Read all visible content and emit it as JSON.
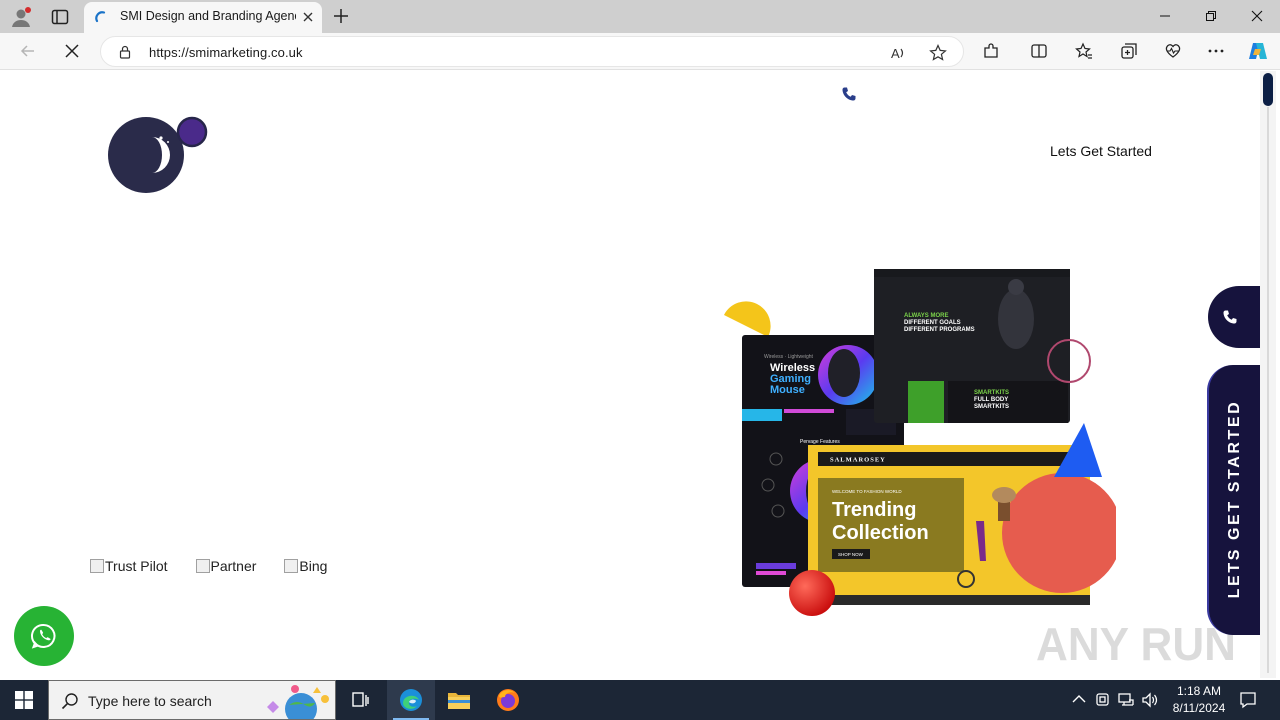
{
  "browser": {
    "tab_title": "SMI Design and Branding Agency",
    "url": "https://smimarketing.co.uk",
    "read_aloud_label": "A"
  },
  "page": {
    "cta_link": "Lets Get Started",
    "partner_images": [
      "Trust Pilot",
      "Partner",
      "Bing"
    ],
    "side_cta": "LETS GET STARTED",
    "hero_mockups": {
      "gaming_headline": "Wireless Gaming Mouse",
      "fitness_headline_1": "DIFFERENT GOALS",
      "fitness_headline_2": "DIFFERENT PROGRAMS",
      "fitness_sub": "FULL BODY SMARTKITS",
      "fashion_brand": "SALMAROSEY",
      "fashion_kicker": "WELCOME TO FASHION WORLD",
      "fashion_headline_1": "Trending",
      "fashion_headline_2": "Collection",
      "fashion_button": "SHOP NOW",
      "gaming_features": "Pervage Features"
    },
    "watermark": "ANY RUN"
  },
  "taskbar": {
    "search_placeholder": "Type here to search",
    "time": "1:18 AM",
    "date": "8/11/2024"
  },
  "colors": {
    "brand_navy": "#16133d",
    "whatsapp_green": "#27b334",
    "tab_bar": "#cfcfcf",
    "taskbar": "#1c2636"
  }
}
